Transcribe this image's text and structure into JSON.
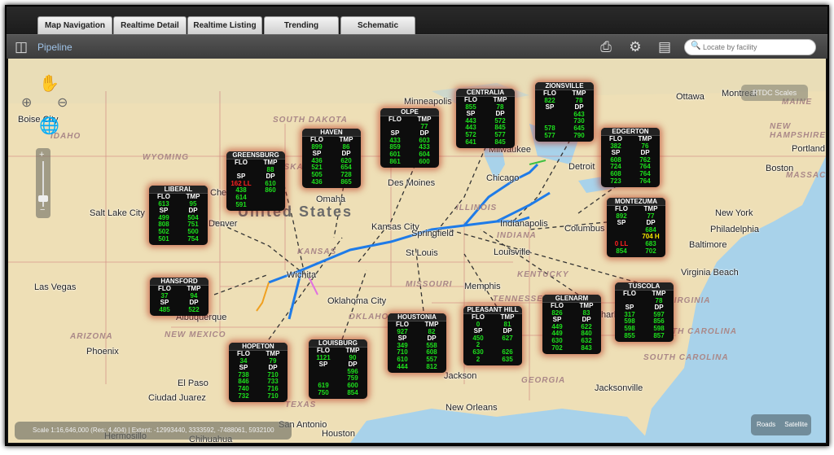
{
  "tabs": [
    {
      "label": "Map Navigation",
      "state": "active"
    },
    {
      "label": "Realtime Detail",
      "state": "disabled"
    },
    {
      "label": "Realtime Listing",
      "state": "normal"
    },
    {
      "label": "Trending",
      "state": "normal"
    },
    {
      "label": "Schematic",
      "state": "normal"
    }
  ],
  "toolbar": {
    "title": "Pipeline",
    "icons": [
      "binoculars-icon",
      "print-icon",
      "gear-icon",
      "map-book-icon"
    ],
    "search_placeholder": "Locate by facility"
  },
  "map": {
    "country_label": "United States",
    "rtdc_button": "RTDC Scales",
    "scale_text": "Scale 1:16,646,000 (Res: 4,404) | Extent:  -12993440, 3333592, -7488061, 5932100",
    "basemap": {
      "roads": "Roads",
      "satellite": "Satellite"
    },
    "cities": [
      "Boise City",
      "Salt Lake City",
      "Las Vegas",
      "Phoenix",
      "Albuquerque",
      "El Paso",
      "Ciudad Juarez",
      "Hermosillo",
      "Chihuahua",
      "Denver",
      "Cheyenne",
      "Omaha",
      "Des Moines",
      "Kansas City",
      "Wichita",
      "Oklahoma City",
      "St Louis",
      "Springfield",
      "Chicago",
      "Milwaukee",
      "Detroit",
      "Indianapolis",
      "Louisville",
      "Columbus",
      "Memphis",
      "Jackson",
      "New Orleans",
      "Houston",
      "San Antonio",
      "Ottawa",
      "Montreal",
      "Portland",
      "Boston",
      "New York",
      "Philadelphia",
      "Baltimore",
      "Virginia Beach",
      "Jacksonville",
      "Charlotte",
      "Minneapolis"
    ],
    "states": [
      "WYOMING",
      "SOUTH DAKOTA",
      "NEBRASKA",
      "KANSAS",
      "MISSOURI",
      "OKLAHOMA",
      "NEW MEXICO",
      "ARIZONA",
      "TEXAS",
      "ILLINOIS",
      "INDIANA",
      "KENTUCKY",
      "TENNESSEE",
      "GEORGIA",
      "SOUTH CAROLINA",
      "NORTH CAROLINA",
      "VIRGINIA",
      "NEW HAMPSHIRE",
      "MASSACHUSETTS",
      "MAINE",
      "IDAHO"
    ]
  },
  "colors": {
    "ok": "#1de01d",
    "alarm_low": "#ff2020",
    "alarm_high": "#f5e600",
    "pipeline": "#1e7be8"
  },
  "facilities": [
    {
      "name": "LIBERAL",
      "rows": [
        [
          "FLO",
          "TMP"
        ],
        [
          "613",
          "95"
        ],
        [
          "SP",
          "DP"
        ],
        [
          "499",
          "504"
        ],
        [
          "808",
          "751"
        ],
        [
          "502",
          "500"
        ],
        [
          "501",
          "754"
        ]
      ]
    },
    {
      "name": "GREENSBURG",
      "rows": [
        [
          "FLO",
          "TMP"
        ],
        [
          "",
          "88"
        ],
        [
          "SP",
          "DP"
        ],
        [
          "162 LL",
          "610"
        ],
        [
          "438",
          "860"
        ],
        [
          "614",
          ""
        ],
        [
          "591",
          ""
        ]
      ]
    },
    {
      "name": "HAVEN",
      "rows": [
        [
          "FLO",
          "TMP"
        ],
        [
          "899",
          "86"
        ],
        [
          "SP",
          "DP"
        ],
        [
          "436",
          "620"
        ],
        [
          "521",
          "654"
        ],
        [
          "505",
          "728"
        ],
        [
          "436",
          "865"
        ]
      ]
    },
    {
      "name": "OLPE",
      "rows": [
        [
          "FLO",
          "TMP"
        ],
        [
          "",
          "77"
        ],
        [
          "SP",
          "DP"
        ],
        [
          "433",
          "603"
        ],
        [
          "859",
          "433"
        ],
        [
          "601",
          "604"
        ],
        [
          "861",
          "600"
        ]
      ]
    },
    {
      "name": "CENTRALIA",
      "rows": [
        [
          "FLO",
          "TMP"
        ],
        [
          "855",
          "78"
        ],
        [
          "SP",
          "DP"
        ],
        [
          "443",
          "572"
        ],
        [
          "443",
          "845"
        ],
        [
          "572",
          "577"
        ],
        [
          "641",
          "845"
        ]
      ]
    },
    {
      "name": "ZIONSVILLE",
      "rows": [
        [
          "FLO",
          "TMP"
        ],
        [
          "822",
          "78"
        ],
        [
          "SP",
          "DP"
        ],
        [
          "",
          "643"
        ],
        [
          "",
          "730"
        ],
        [
          "578",
          "645"
        ],
        [
          "577",
          "790"
        ]
      ]
    },
    {
      "name": "EDGERTON",
      "rows": [
        [
          "FLO",
          "TMP"
        ],
        [
          "382",
          "76"
        ],
        [
          "SP",
          "DP"
        ],
        [
          "608",
          "762"
        ],
        [
          "724",
          "764"
        ],
        [
          "608",
          "764"
        ],
        [
          "723",
          "764"
        ]
      ]
    },
    {
      "name": "MONTEZUMA",
      "rows": [
        [
          "FLO",
          "TMP"
        ],
        [
          "892",
          "77"
        ],
        [
          "SP",
          "DP"
        ],
        [
          "",
          "684"
        ],
        [
          "",
          "704 H"
        ],
        [
          "0 LL",
          "683"
        ],
        [
          "854",
          "702"
        ]
      ]
    },
    {
      "name": "HANSFORD",
      "rows": [
        [
          "FLO",
          "TMP"
        ],
        [
          "37",
          "94"
        ],
        [
          "SP",
          "DP"
        ],
        [
          "485",
          "522"
        ]
      ]
    },
    {
      "name": "HOPETON",
      "rows": [
        [
          "FLO",
          "TMP"
        ],
        [
          "34",
          "79"
        ],
        [
          "SP",
          "DP"
        ],
        [
          "738",
          "710"
        ],
        [
          "846",
          "733"
        ],
        [
          "740",
          "716"
        ],
        [
          "732",
          "710"
        ]
      ]
    },
    {
      "name": "LOUISBURG",
      "rows": [
        [
          "FLO",
          "TMP"
        ],
        [
          "1121",
          "90"
        ],
        [
          "SP",
          "DP"
        ],
        [
          "",
          "596"
        ],
        [
          "",
          "759"
        ],
        [
          "619",
          "600"
        ],
        [
          "750",
          "854"
        ]
      ]
    },
    {
      "name": "HOUSTONIA",
      "rows": [
        [
          "FLO",
          "TMP"
        ],
        [
          "927",
          "82"
        ],
        [
          "SP",
          "DP"
        ],
        [
          "349",
          "558"
        ],
        [
          "710",
          "608"
        ],
        [
          "610",
          "557"
        ],
        [
          "444",
          "812"
        ]
      ]
    },
    {
      "name": "PLEASANT HILL",
      "rows": [
        [
          "FLO",
          "TMP"
        ],
        [
          "0",
          "81"
        ],
        [
          "SP",
          "DP"
        ],
        [
          "450",
          "627"
        ],
        [
          "2",
          ""
        ],
        [
          "630",
          "626"
        ],
        [
          "2",
          "635"
        ]
      ]
    },
    {
      "name": "GLENARM",
      "rows": [
        [
          "FLO",
          "TMP"
        ],
        [
          "826",
          "83"
        ],
        [
          "SP",
          "DP"
        ],
        [
          "449",
          "622"
        ],
        [
          "449",
          "840"
        ],
        [
          "630",
          "632"
        ],
        [
          "702",
          "843"
        ]
      ]
    },
    {
      "name": "TUSCOLA",
      "rows": [
        [
          "FLO",
          "TMP"
        ],
        [
          "",
          "78"
        ],
        [
          "SP",
          "DP"
        ],
        [
          "317",
          "597"
        ],
        [
          "598",
          "856"
        ],
        [
          "598",
          "598"
        ],
        [
          "855",
          "857"
        ]
      ]
    }
  ]
}
